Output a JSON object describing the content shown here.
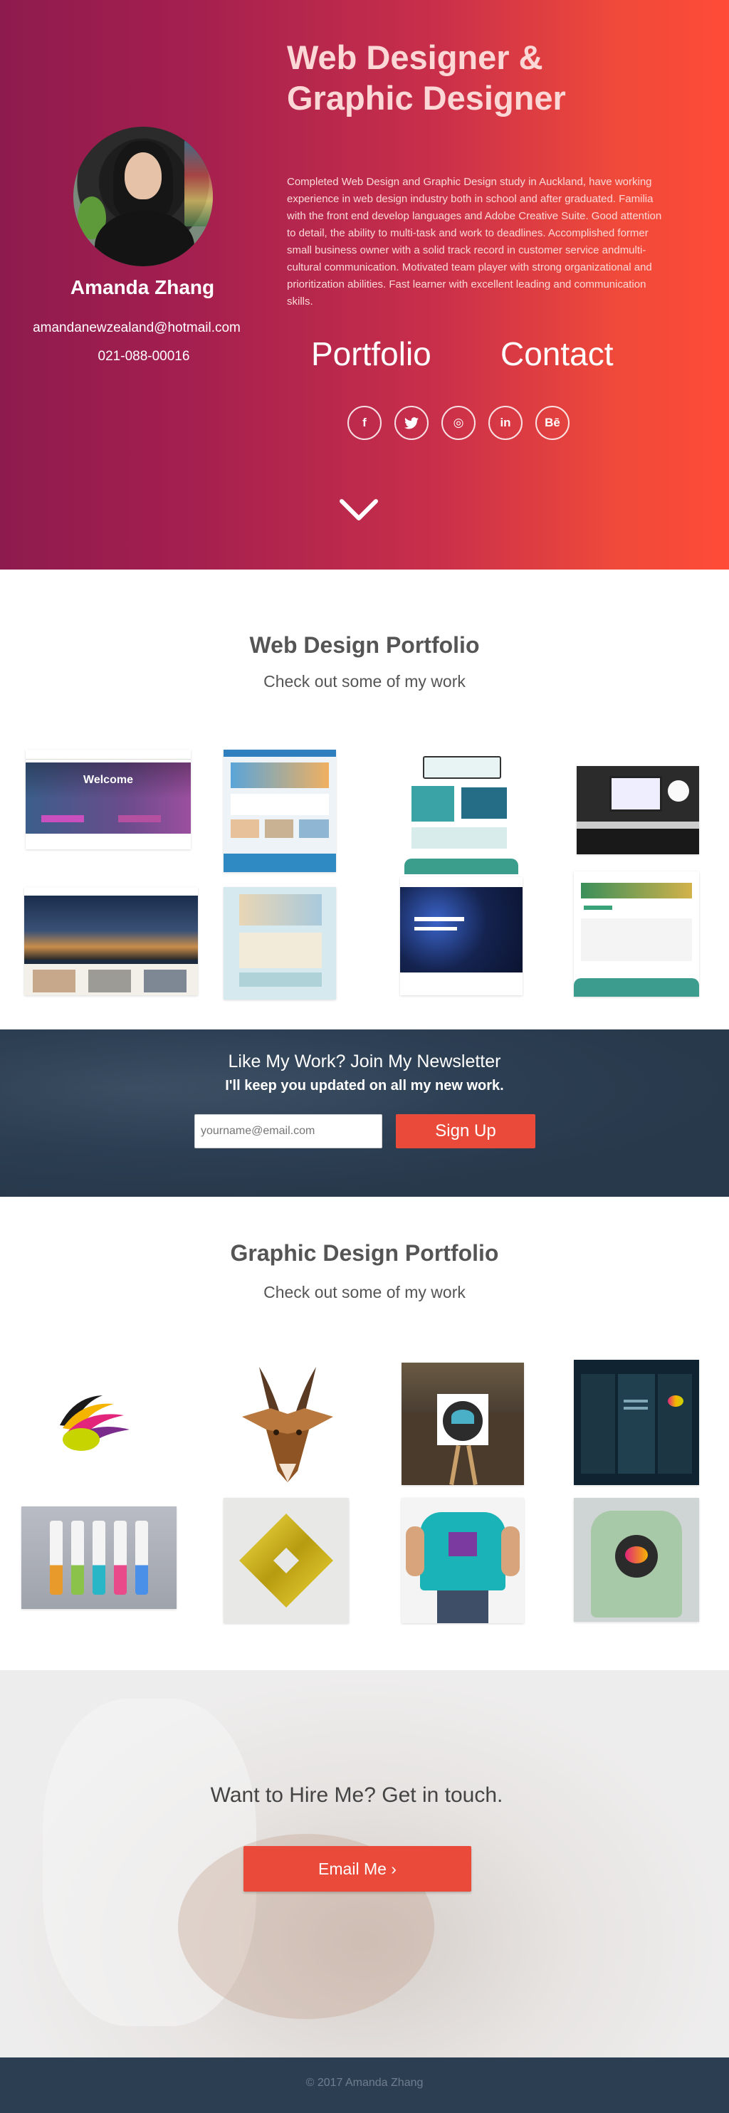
{
  "hero": {
    "title_line1": "Web Designer &",
    "title_line2": "Graphic Designer",
    "bio": "Completed Web Design and Graphic Design study in Auckland, have working experience in web design industry both in school and after graduated. Familia with the front end develop languages and Adobe Creative Suite. Good attention to detail, the ability to multi-task and work to deadlines. Accomplished former small business owner with a solid track record in customer service andmulti-cultural communication. Motivated team player with strong organizational and prioritization abilities. Fast learner with excellent leading and communication skills.",
    "nav_portfolio": "Portfolio",
    "nav_contact": "Contact",
    "socials": [
      {
        "icon": "facebook-icon",
        "glyph": "f"
      },
      {
        "icon": "twitter-icon",
        "glyph": "t"
      },
      {
        "icon": "dribbble-icon",
        "glyph": "◎"
      },
      {
        "icon": "linkedin-icon",
        "glyph": "in"
      },
      {
        "icon": "behance-icon",
        "glyph": "Bē"
      }
    ],
    "gradient": [
      "#8e1b4e",
      "#ff4b38"
    ]
  },
  "profile": {
    "name": "Amanda Zhang",
    "email": "amandanewzealand@hotmail.com",
    "phone": "021-088-00016"
  },
  "web_portfolio": {
    "title": "Web Design Portfolio",
    "subtitle": "Check out some of my work",
    "thumb1_caption": "Welcome"
  },
  "newsletter": {
    "title": "Like My Work? Join My Newsletter",
    "subtitle": "I'll keep you updated on all my new work.",
    "placeholder": "yourname@email.com",
    "button": "Sign Up"
  },
  "graphic_portfolio": {
    "title": "Graphic Design Portfolio",
    "subtitle": "Check out some of my work"
  },
  "contact": {
    "heading": "Want to Hire Me? Get in touch.",
    "button": "Email Me ›"
  },
  "footer": {
    "copyright": "© 2017 Amanda Zhang"
  },
  "colors": {
    "accent": "#e94a3a",
    "navy": "#2c3e52"
  }
}
